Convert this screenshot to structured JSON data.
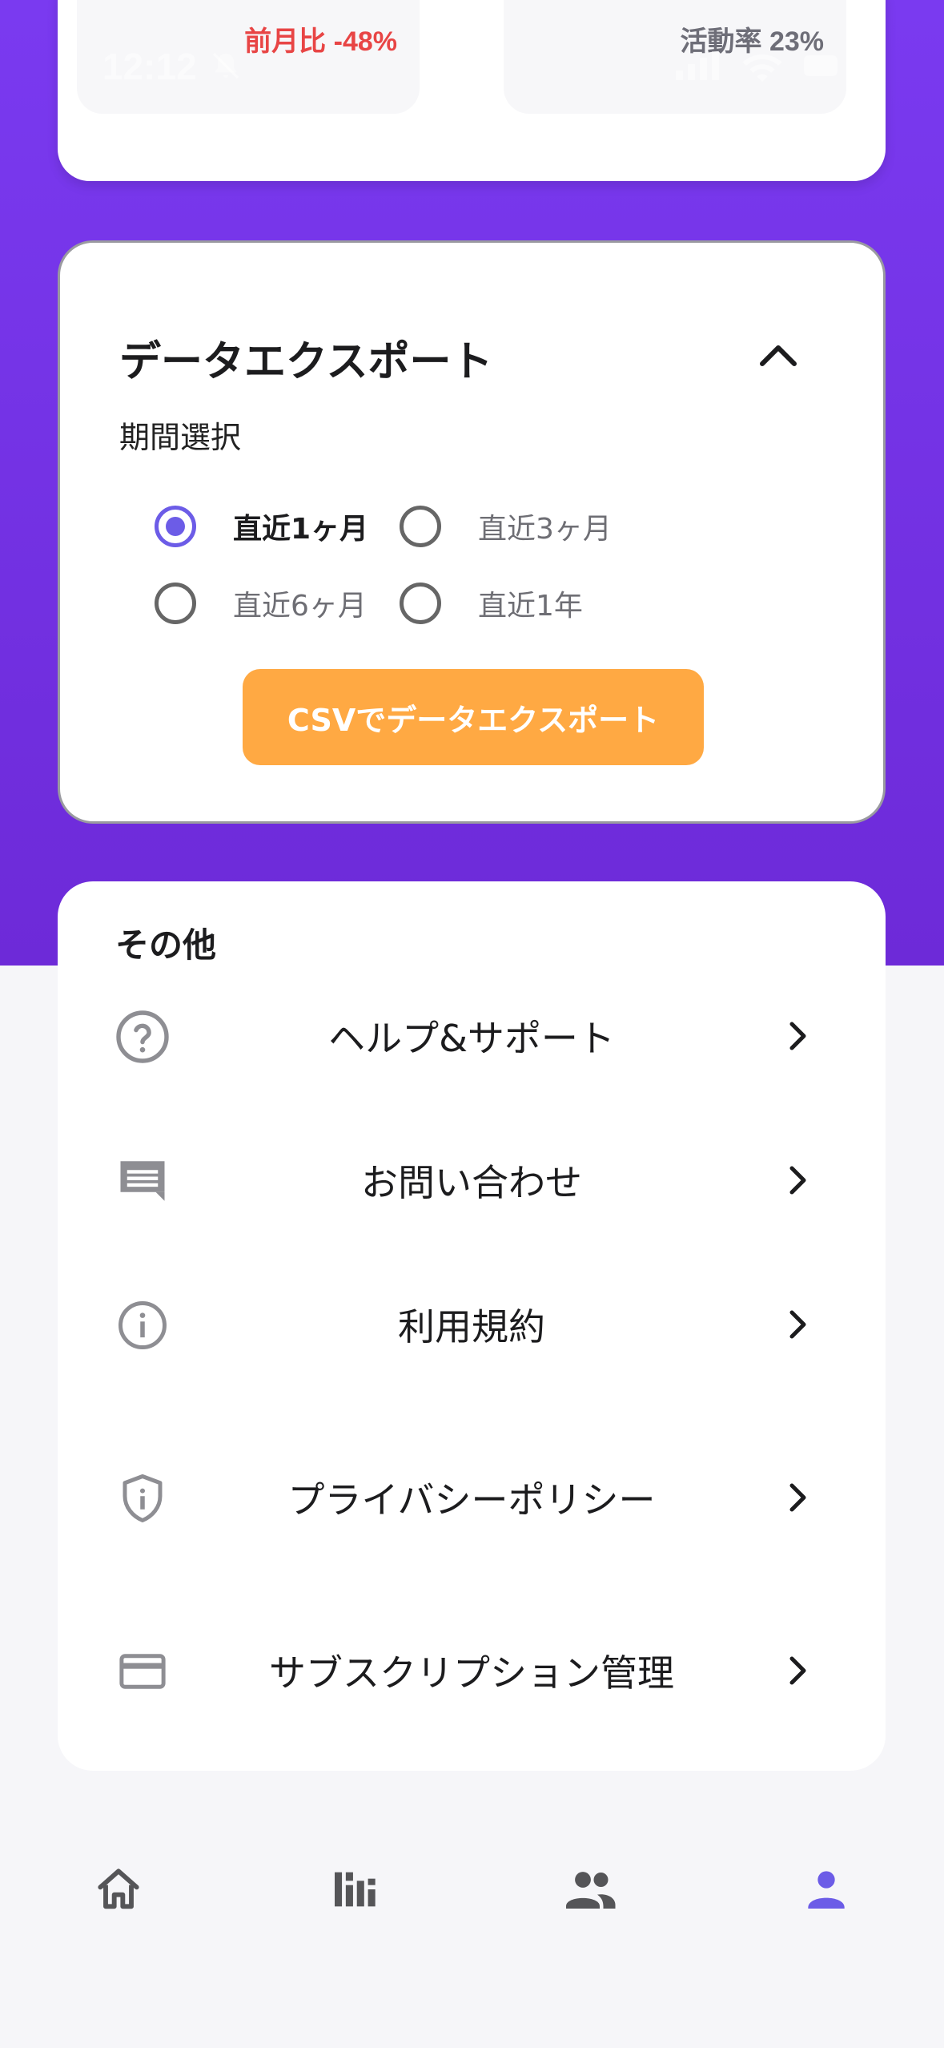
{
  "status_bar": {
    "time": "12:12"
  },
  "stats": {
    "left_change": "前月比 -48%",
    "right_activity": "活動率 23%"
  },
  "export": {
    "title": "データエクスポート",
    "period_label": "期間選択",
    "options": [
      {
        "label": "直近1ヶ月",
        "checked": true
      },
      {
        "label": "直近3ヶ月",
        "checked": false
      },
      {
        "label": "直近6ヶ月",
        "checked": false
      },
      {
        "label": "直近1年",
        "checked": false
      }
    ],
    "button_label": "CSVでデータエクスポート"
  },
  "other": {
    "title": "その他",
    "items": [
      {
        "label": "ヘルプ&サポート",
        "icon": "help-circle-icon"
      },
      {
        "label": "お問い合わせ",
        "icon": "chat-message-icon"
      },
      {
        "label": "利用規約",
        "icon": "info-icon"
      },
      {
        "label": "プライバシーポリシー",
        "icon": "shield-icon"
      },
      {
        "label": "サブスクリプション管理",
        "icon": "credit-card-icon"
      }
    ]
  },
  "bottom_nav": {
    "items": [
      {
        "icon": "home-icon",
        "active": false
      },
      {
        "icon": "bar-chart-icon",
        "active": false
      },
      {
        "icon": "people-icon",
        "active": false
      },
      {
        "icon": "person-icon",
        "active": true
      }
    ]
  },
  "colors": {
    "purple": "#7a3af0",
    "accent": "#6c5ce7",
    "orange": "#ffa943",
    "red": "#e84545"
  }
}
